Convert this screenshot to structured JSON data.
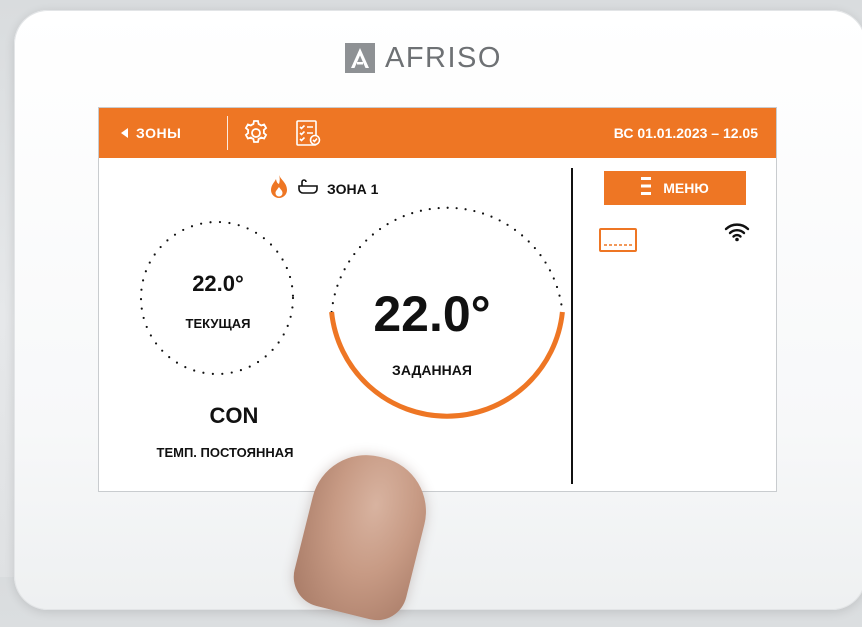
{
  "brand": {
    "name": "AFRISO",
    "icon": "afriso-logo-icon"
  },
  "topbar": {
    "back_label": "ЗОНЫ",
    "settings_icon": "gear-icon",
    "schedule_icon": "checklist-icon",
    "datetime": "ВС 01.01.2023 – 12.05"
  },
  "zone": {
    "name": "ЗОНА 1",
    "status_icon": "flame-icon",
    "type_icon": "bathtub-icon"
  },
  "current": {
    "value": "22.0°",
    "label": "ТЕКУЩАЯ"
  },
  "setpoint": {
    "value": "22.0°",
    "label": "ЗАДАННАЯ"
  },
  "mode": {
    "code": "CON",
    "label": "ТЕМП. ПОСТОЯННАЯ"
  },
  "menu": {
    "label": "МЕНЮ",
    "icon": "menu-bars-icon"
  },
  "status_icons": [
    "device-icon",
    "wifi-icon"
  ],
  "colors": {
    "accent": "#ee7624",
    "text": "#111111",
    "background": "#ffffff"
  }
}
